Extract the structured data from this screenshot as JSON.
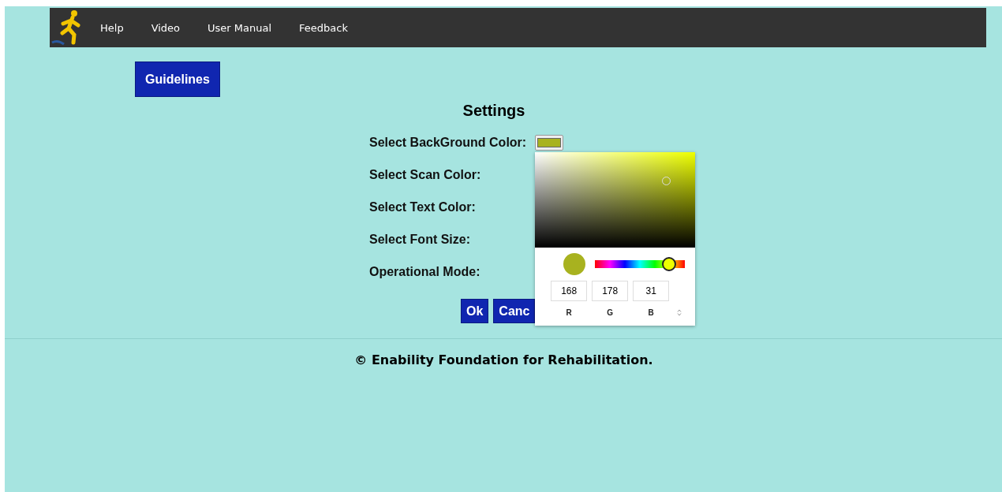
{
  "nav": {
    "items": [
      "Help",
      "Video",
      "User Manual",
      "Feedback"
    ]
  },
  "guidelines_button": "Guidelines",
  "settings": {
    "title": "Settings",
    "rows": [
      {
        "label": "Select BackGround Color:",
        "kind": "color"
      },
      {
        "label": "Select Scan Color:",
        "kind": "plain"
      },
      {
        "label": "Select Text Color:",
        "kind": "plain"
      },
      {
        "label": "Select Font Size:",
        "kind": "plain"
      },
      {
        "label": "Operational Mode:",
        "kind": "plain"
      }
    ],
    "buttons": [
      "Ok",
      "Canc"
    ]
  },
  "color_picker": {
    "color": "#a8b21f",
    "hue_slider": {
      "level": 0.82
    },
    "channels": [
      {
        "value": "168",
        "label": "R"
      },
      {
        "value": "178",
        "label": "G"
      },
      {
        "value": "31",
        "label": "B"
      }
    ]
  },
  "footer": "© Enability Foundation for Rehabilitation."
}
